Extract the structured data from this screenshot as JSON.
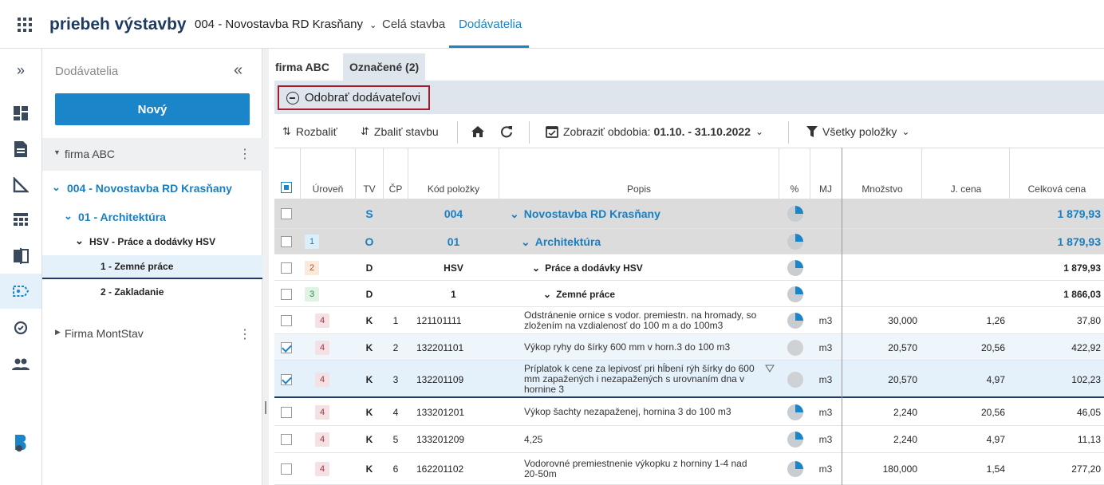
{
  "header": {
    "app_title": "priebeh výstavby",
    "project": "004 - Novostavba RD Krasňany",
    "tabs": [
      "Celá stavba",
      "Dodávatelia"
    ],
    "active_tab": "Dodávatelia"
  },
  "tree": {
    "title": "Dodávatelia",
    "new_label": "Nový",
    "items": [
      {
        "label": "firma ABC"
      },
      {
        "label": "004 - Novostavba RD Krasňany"
      },
      {
        "label": "01 - Architektúra"
      },
      {
        "label": "HSV - Práce a dodávky HSV"
      },
      {
        "label": "1 - Zemné práce"
      },
      {
        "label": "2 - Zakladanie"
      },
      {
        "label": "Firma MontStav"
      }
    ]
  },
  "main": {
    "tabs": [
      "firma ABC",
      "Označené (2)"
    ],
    "remove_label": "Odobrať dodávateľovi"
  },
  "toolbar": {
    "expand": "Rozbaliť",
    "collapse": "Zbaliť stavbu",
    "period_label": "Zobraziť obdobia:",
    "period_value": "01.10. - 31.10.2022",
    "filter": "Všetky položky"
  },
  "columns": [
    "Úroveň",
    "TV",
    "ČP",
    "Kód položky",
    "Popis",
    "%",
    "MJ",
    "Množstvo",
    "J. cena",
    "Celková cena"
  ],
  "rows": [
    {
      "lvl": "",
      "tv": "S",
      "cp": "",
      "code": "004",
      "desc": "Novostavba RD Krasňany",
      "mj": "",
      "qty": "",
      "unit": "",
      "total": "1 879,93"
    },
    {
      "lvl": "1",
      "tv": "O",
      "cp": "",
      "code": "01",
      "desc": "Architektúra",
      "mj": "",
      "qty": "",
      "unit": "",
      "total": "1 879,93"
    },
    {
      "lvl": "2",
      "tv": "D",
      "cp": "",
      "code": "HSV",
      "desc": "Práce a dodávky HSV",
      "mj": "",
      "qty": "",
      "unit": "",
      "total": "1 879,93"
    },
    {
      "lvl": "3",
      "tv": "D",
      "cp": "",
      "code": "1",
      "desc": "Zemné práce",
      "mj": "",
      "qty": "",
      "unit": "",
      "total": "1 866,03"
    },
    {
      "lvl": "4",
      "tv": "K",
      "cp": "1",
      "code": "121101111",
      "desc": "Odstránenie ornice s vodor. premiestn. na hromady, so zložením na vzdialenosť do 100 m a do 100m3",
      "mj": "m3",
      "qty": "30,000",
      "unit": "1,26",
      "total": "37,80"
    },
    {
      "lvl": "4",
      "tv": "K",
      "cp": "2",
      "code": "132201101",
      "desc": "Výkop ryhy do šírky 600 mm v horn.3 do 100 m3",
      "mj": "m3",
      "qty": "20,570",
      "unit": "20,56",
      "total": "422,92"
    },
    {
      "lvl": "4",
      "tv": "K",
      "cp": "3",
      "code": "132201109",
      "desc": "Príplatok k cene za lepivosť pri hĺbení rýh šírky do 600 mm zapažených i nezapažených s urovnaním dna v hornine 3",
      "mj": "m3",
      "qty": "20,570",
      "unit": "4,97",
      "total": "102,23"
    },
    {
      "lvl": "4",
      "tv": "K",
      "cp": "4",
      "code": "133201201",
      "desc": "Výkop šachty nezapaženej, hornina 3 do 100 m3",
      "mj": "m3",
      "qty": "2,240",
      "unit": "20,56",
      "total": "46,05"
    },
    {
      "lvl": "4",
      "tv": "K",
      "cp": "5",
      "code": "133201209",
      "desc": "4,25",
      "mj": "m3",
      "qty": "2,240",
      "unit": "4,97",
      "total": "11,13"
    },
    {
      "lvl": "4",
      "tv": "K",
      "cp": "6",
      "code": "162201102",
      "desc": "Vodorovné premiestnenie výkopku z horniny 1-4 nad 20-50m",
      "mj": "m3",
      "qty": "180,000",
      "unit": "1,54",
      "total": "277,20"
    }
  ]
}
